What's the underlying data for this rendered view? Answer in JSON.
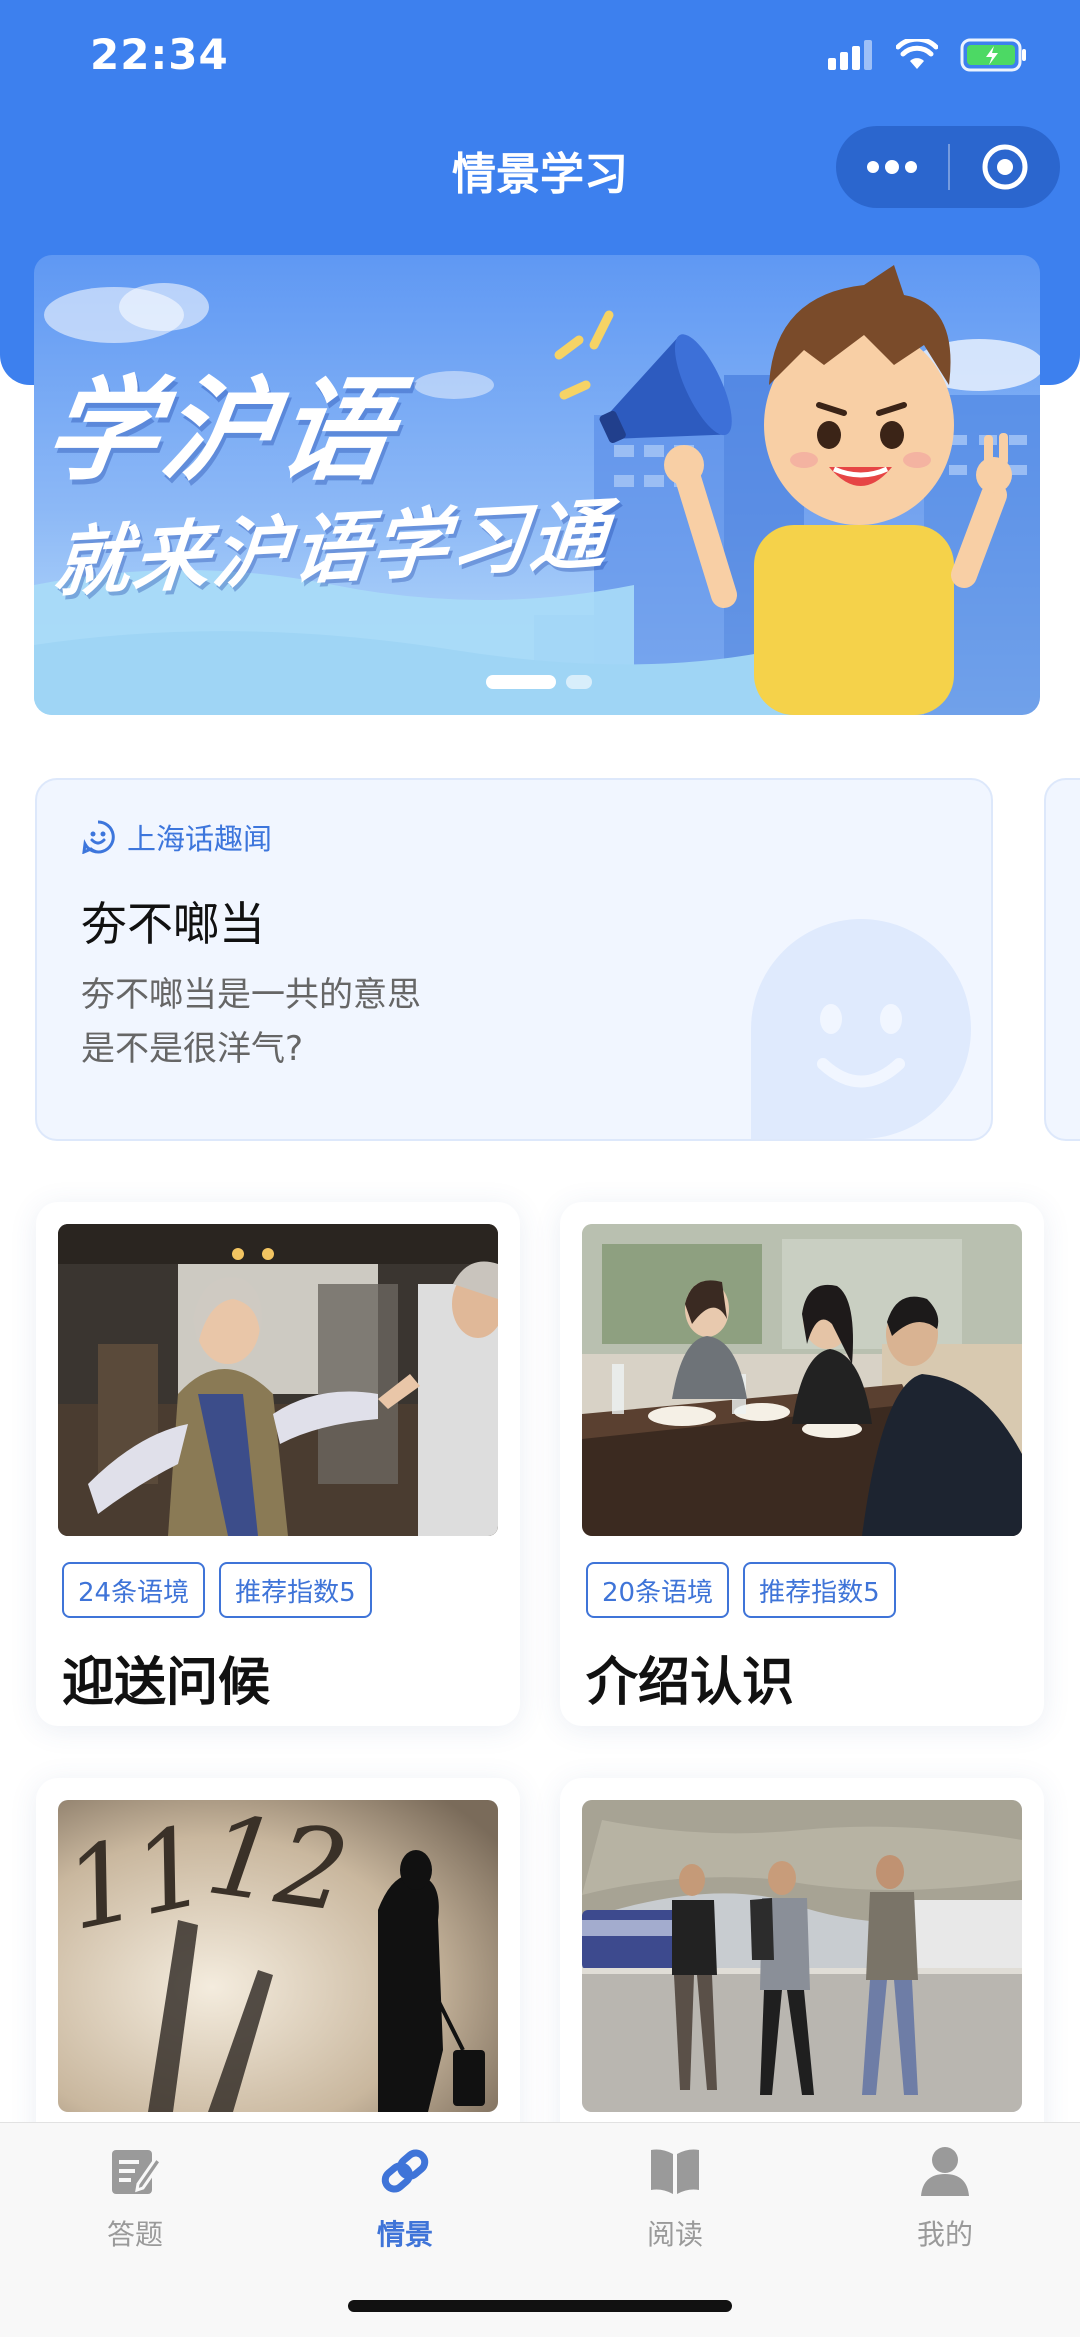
{
  "status_bar": {
    "time": "22:34"
  },
  "header": {
    "title": "情景学习"
  },
  "banner": {
    "line1": "学沪语",
    "line2": "就来沪语学习通"
  },
  "fun_card": {
    "tag": "上海话趣闻",
    "title": "夯不啷当",
    "desc_line1": "夯不啷当是一共的意思",
    "desc_line2": "是不是很洋气?"
  },
  "scenes": [
    {
      "title": "迎送问候",
      "count": "24条语境",
      "score": "推荐指数5"
    },
    {
      "title": "介绍认识",
      "count": "20条语境",
      "score": "推荐指数5"
    },
    {
      "title": "",
      "count": "",
      "score": ""
    },
    {
      "title": "",
      "count": "",
      "score": ""
    }
  ],
  "tabbar": {
    "items": [
      {
        "label": "答题",
        "icon": "quiz-edit-icon"
      },
      {
        "label": "情景",
        "icon": "link-icon"
      },
      {
        "label": "阅读",
        "icon": "book-icon"
      },
      {
        "label": "我的",
        "icon": "person-icon"
      }
    ],
    "active": "情景"
  },
  "colors": {
    "primary": "#3d80ee",
    "accent": "#3f74d8",
    "inactive": "#9a9a9a"
  }
}
